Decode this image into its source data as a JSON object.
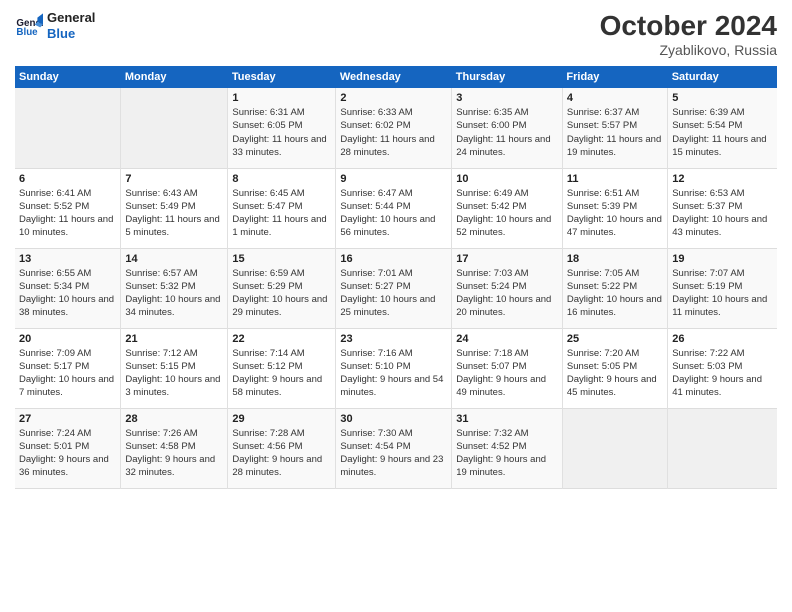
{
  "logo": {
    "line1": "General",
    "line2": "Blue"
  },
  "title": "October 2024",
  "location": "Zyablikovo, Russia",
  "weekdays": [
    "Sunday",
    "Monday",
    "Tuesday",
    "Wednesday",
    "Thursday",
    "Friday",
    "Saturday"
  ],
  "weeks": [
    [
      {
        "day": "",
        "empty": true
      },
      {
        "day": "",
        "empty": true
      },
      {
        "day": "1",
        "sunrise": "6:31 AM",
        "sunset": "6:05 PM",
        "daylight": "11 hours and 33 minutes."
      },
      {
        "day": "2",
        "sunrise": "6:33 AM",
        "sunset": "6:02 PM",
        "daylight": "11 hours and 28 minutes."
      },
      {
        "day": "3",
        "sunrise": "6:35 AM",
        "sunset": "6:00 PM",
        "daylight": "11 hours and 24 minutes."
      },
      {
        "day": "4",
        "sunrise": "6:37 AM",
        "sunset": "5:57 PM",
        "daylight": "11 hours and 19 minutes."
      },
      {
        "day": "5",
        "sunrise": "6:39 AM",
        "sunset": "5:54 PM",
        "daylight": "11 hours and 15 minutes."
      }
    ],
    [
      {
        "day": "6",
        "sunrise": "6:41 AM",
        "sunset": "5:52 PM",
        "daylight": "11 hours and 10 minutes."
      },
      {
        "day": "7",
        "sunrise": "6:43 AM",
        "sunset": "5:49 PM",
        "daylight": "11 hours and 5 minutes."
      },
      {
        "day": "8",
        "sunrise": "6:45 AM",
        "sunset": "5:47 PM",
        "daylight": "11 hours and 1 minute."
      },
      {
        "day": "9",
        "sunrise": "6:47 AM",
        "sunset": "5:44 PM",
        "daylight": "10 hours and 56 minutes."
      },
      {
        "day": "10",
        "sunrise": "6:49 AM",
        "sunset": "5:42 PM",
        "daylight": "10 hours and 52 minutes."
      },
      {
        "day": "11",
        "sunrise": "6:51 AM",
        "sunset": "5:39 PM",
        "daylight": "10 hours and 47 minutes."
      },
      {
        "day": "12",
        "sunrise": "6:53 AM",
        "sunset": "5:37 PM",
        "daylight": "10 hours and 43 minutes."
      }
    ],
    [
      {
        "day": "13",
        "sunrise": "6:55 AM",
        "sunset": "5:34 PM",
        "daylight": "10 hours and 38 minutes."
      },
      {
        "day": "14",
        "sunrise": "6:57 AM",
        "sunset": "5:32 PM",
        "daylight": "10 hours and 34 minutes."
      },
      {
        "day": "15",
        "sunrise": "6:59 AM",
        "sunset": "5:29 PM",
        "daylight": "10 hours and 29 minutes."
      },
      {
        "day": "16",
        "sunrise": "7:01 AM",
        "sunset": "5:27 PM",
        "daylight": "10 hours and 25 minutes."
      },
      {
        "day": "17",
        "sunrise": "7:03 AM",
        "sunset": "5:24 PM",
        "daylight": "10 hours and 20 minutes."
      },
      {
        "day": "18",
        "sunrise": "7:05 AM",
        "sunset": "5:22 PM",
        "daylight": "10 hours and 16 minutes."
      },
      {
        "day": "19",
        "sunrise": "7:07 AM",
        "sunset": "5:19 PM",
        "daylight": "10 hours and 11 minutes."
      }
    ],
    [
      {
        "day": "20",
        "sunrise": "7:09 AM",
        "sunset": "5:17 PM",
        "daylight": "10 hours and 7 minutes."
      },
      {
        "day": "21",
        "sunrise": "7:12 AM",
        "sunset": "5:15 PM",
        "daylight": "10 hours and 3 minutes."
      },
      {
        "day": "22",
        "sunrise": "7:14 AM",
        "sunset": "5:12 PM",
        "daylight": "9 hours and 58 minutes."
      },
      {
        "day": "23",
        "sunrise": "7:16 AM",
        "sunset": "5:10 PM",
        "daylight": "9 hours and 54 minutes."
      },
      {
        "day": "24",
        "sunrise": "7:18 AM",
        "sunset": "5:07 PM",
        "daylight": "9 hours and 49 minutes."
      },
      {
        "day": "25",
        "sunrise": "7:20 AM",
        "sunset": "5:05 PM",
        "daylight": "9 hours and 45 minutes."
      },
      {
        "day": "26",
        "sunrise": "7:22 AM",
        "sunset": "5:03 PM",
        "daylight": "9 hours and 41 minutes."
      }
    ],
    [
      {
        "day": "27",
        "sunrise": "7:24 AM",
        "sunset": "5:01 PM",
        "daylight": "9 hours and 36 minutes."
      },
      {
        "day": "28",
        "sunrise": "7:26 AM",
        "sunset": "4:58 PM",
        "daylight": "9 hours and 32 minutes."
      },
      {
        "day": "29",
        "sunrise": "7:28 AM",
        "sunset": "4:56 PM",
        "daylight": "9 hours and 28 minutes."
      },
      {
        "day": "30",
        "sunrise": "7:30 AM",
        "sunset": "4:54 PM",
        "daylight": "9 hours and 23 minutes."
      },
      {
        "day": "31",
        "sunrise": "7:32 AM",
        "sunset": "4:52 PM",
        "daylight": "9 hours and 19 minutes."
      },
      {
        "day": "",
        "empty": true
      },
      {
        "day": "",
        "empty": true
      }
    ]
  ]
}
